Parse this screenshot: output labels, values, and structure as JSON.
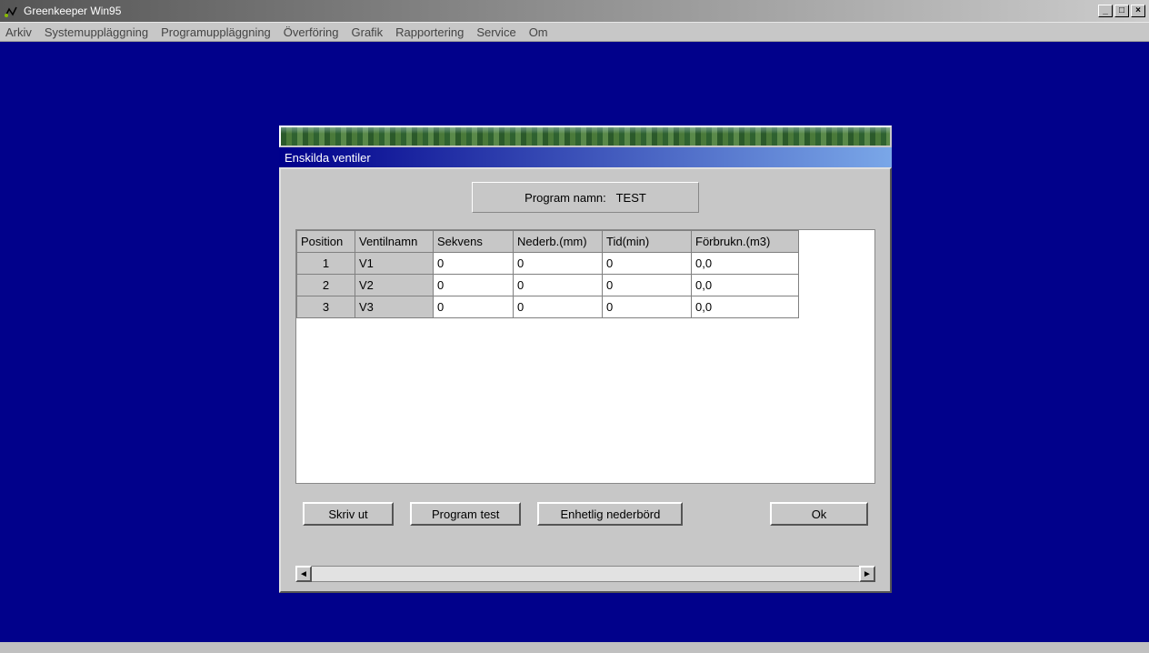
{
  "app": {
    "title": "Greenkeeper Win95"
  },
  "menu": {
    "arkiv": "Arkiv",
    "system": "Systemuppläggning",
    "program": "Programuppläggning",
    "overforing": "Överföring",
    "grafik": "Grafik",
    "rapport": "Rapportering",
    "service": "Service",
    "om": "Om"
  },
  "dialog": {
    "title": "Enskilda ventiler",
    "program_label": "Program namn:",
    "program_name": "TEST",
    "headers": {
      "position": "Position",
      "ventilnamn": "Ventilnamn",
      "sekvens": "Sekvens",
      "nederb": "Nederb.(mm)",
      "tid": "Tid(min)",
      "forbrukn": "Förbrukn.(m3)"
    },
    "rows": [
      {
        "pos": "1",
        "namn": "V1",
        "sekvens": "0",
        "nederb": "0",
        "tid": "0",
        "forbr": "0,0"
      },
      {
        "pos": "2",
        "namn": "V2",
        "sekvens": "0",
        "nederb": "0",
        "tid": "0",
        "forbr": "0,0"
      },
      {
        "pos": "3",
        "namn": "V3",
        "sekvens": "0",
        "nederb": "0",
        "tid": "0",
        "forbr": "0,0"
      }
    ],
    "buttons": {
      "skriv": "Skriv ut",
      "progtest": "Program test",
      "enhetlig": "Enhetlig nederbörd",
      "ok": "Ok"
    }
  }
}
